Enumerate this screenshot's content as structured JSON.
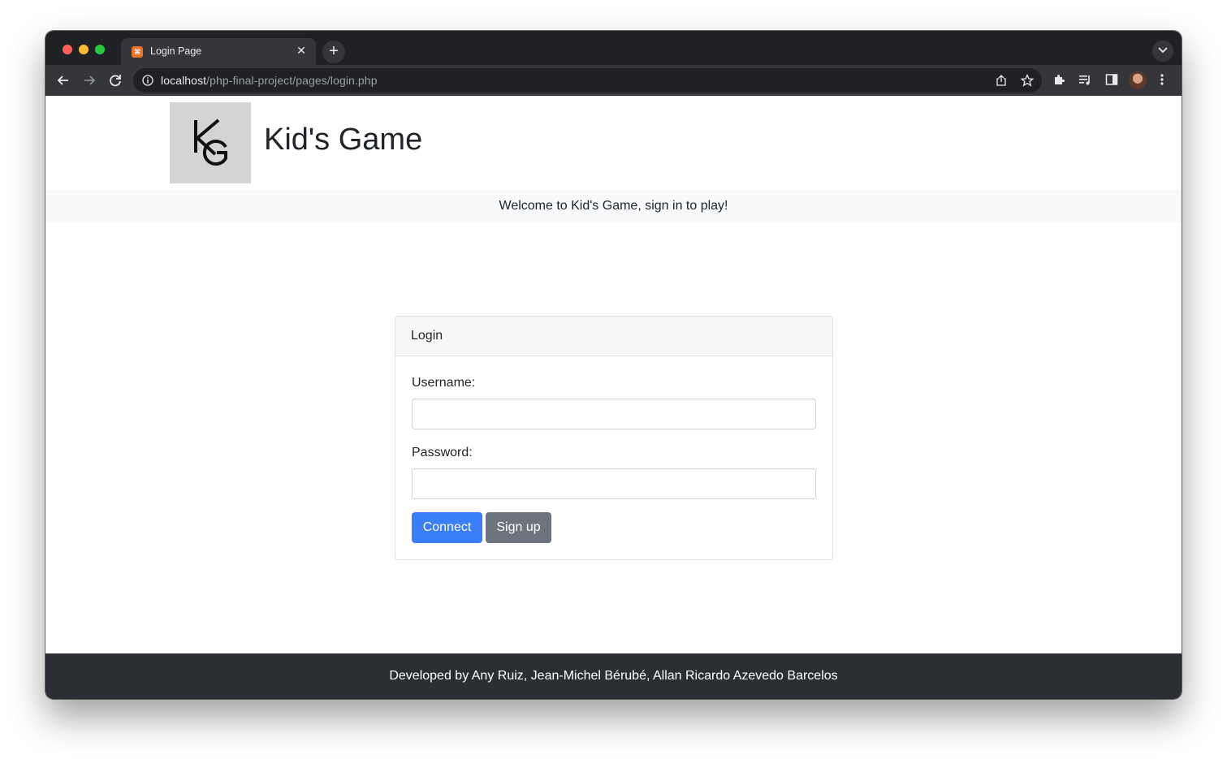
{
  "browser": {
    "tab_title": "Login Page",
    "tab_favicon_text": "⌘",
    "url_host": "localhost",
    "url_path": "/php-final-project/pages/login.php",
    "icons": [
      "back-icon",
      "forward-icon",
      "reload-icon",
      "info-icon",
      "share-icon",
      "star-icon",
      "extensions-icon",
      "media-icon",
      "sidebar-icon",
      "profile-avatar",
      "menu-icon"
    ]
  },
  "header": {
    "logo_text": "KG",
    "site_title": "Kid's Game"
  },
  "welcome": {
    "message": "Welcome to Kid's Game, sign in to play!"
  },
  "login_card": {
    "title": "Login",
    "username_label": "Username:",
    "username_value": "",
    "password_label": "Password:",
    "password_value": "",
    "connect_label": "Connect",
    "signup_label": "Sign up"
  },
  "footer": {
    "text": "Developed by Any Ruiz, Jean-Michel Bérubé, Allan Ricardo Azevedo Barcelos"
  },
  "colors": {
    "primary_button": "#3b7ff6",
    "secondary_button": "#6c757d",
    "footer_bg": "#2b2e33",
    "welcome_bg": "#f8f9fa"
  }
}
